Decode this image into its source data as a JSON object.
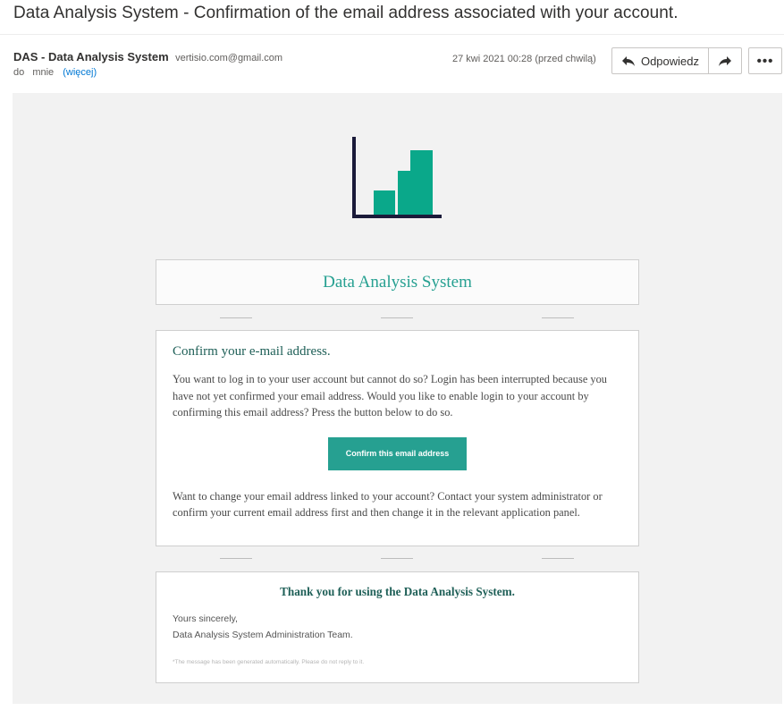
{
  "subject": "Data Analysis System - Confirmation of the email address associated with your account.",
  "sender": {
    "name": "DAS - Data Analysis System",
    "email": "vertisio.com@gmail.com"
  },
  "recipient": {
    "to_label": "do",
    "name": "mnie",
    "more_link": "(więcej)"
  },
  "date": "27 kwi 2021 00:28 (przed chwilą)",
  "toolbar": {
    "reply_label": "Odpowiedz",
    "more_label": "•••"
  },
  "email": {
    "brand_title": "Data Analysis System",
    "logo_colors": {
      "axis": "#1b1b3a",
      "bars": "#0aa88a"
    },
    "main": {
      "heading": "Confirm your e-mail address.",
      "paragraph1": "You want to log in to your user account but cannot do so? Login has been interrupted because you have not yet confirmed your email address. Would you like to enable login to your account by confirming this email address? Press the button below to do so.",
      "button_label": "Confirm this email address",
      "paragraph2": "Want to change your email address linked to your account? Contact your system administrator or confirm your current email address first and then change it in the relevant application panel."
    },
    "footer": {
      "thanks": "Thank you for using the Data Analysis System.",
      "sincerely": "Yours sincerely,",
      "team": "Data Analysis System Administration Team.",
      "auto_note": "*The message has been generated automatically. Please do not reply to it."
    },
    "accent_color": "#26a091"
  }
}
